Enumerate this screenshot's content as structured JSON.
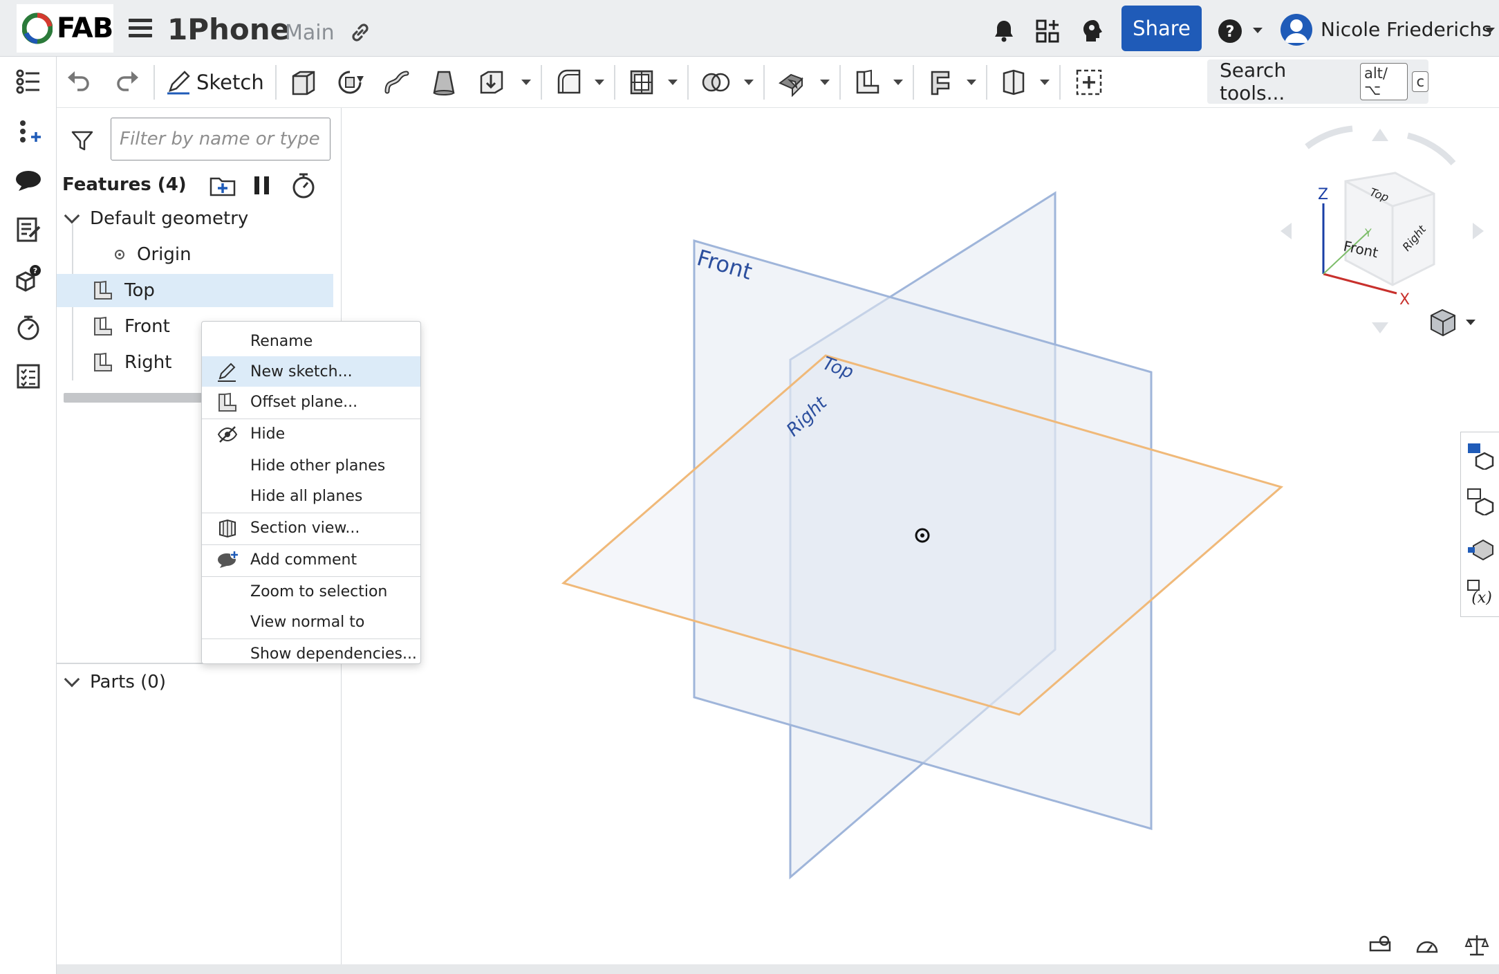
{
  "app": {
    "logo_text": "FAB",
    "document_title": "1Phone",
    "branch": "Main"
  },
  "header": {
    "share_label": "Share",
    "user_name": "Nicole Friederichs"
  },
  "toolbar": {
    "sketch_label": "Sketch",
    "search_label": "Search tools...",
    "search_shortcut_mod": "alt/⌥",
    "search_shortcut_key": "c"
  },
  "feature_panel": {
    "filter_placeholder": "Filter by name or type",
    "features_title": "Features (4)",
    "default_geometry_label": "Default geometry",
    "items": [
      {
        "label": "Origin"
      },
      {
        "label": "Top"
      },
      {
        "label": "Front"
      },
      {
        "label": "Right"
      }
    ],
    "parts_title": "Parts (0)"
  },
  "context_menu": {
    "items": [
      {
        "label": "Rename"
      },
      {
        "label": "New sketch..."
      },
      {
        "label": "Offset plane..."
      },
      {
        "label": "Hide"
      },
      {
        "label": "Hide other planes"
      },
      {
        "label": "Hide all planes"
      },
      {
        "label": "Section view..."
      },
      {
        "label": "Add comment"
      },
      {
        "label": "Zoom to selection"
      },
      {
        "label": "View normal to"
      },
      {
        "label": "Show dependencies..."
      }
    ]
  },
  "viewport": {
    "plane_labels": {
      "front": "Front",
      "top": "Top",
      "right": "Right"
    },
    "view_cube": {
      "top": "Top",
      "front": "Front",
      "right": "Right",
      "axis_x": "X",
      "axis_y": "Y",
      "axis_z": "Z"
    }
  },
  "colors": {
    "share_button": "#1f5bb8",
    "selection_highlight": "#dcebf8",
    "plane_blue": "#8aa6d6",
    "plane_orange": "#f0b979",
    "axis_x": "#c8302c",
    "axis_y": "#7dbd6a",
    "axis_z": "#1a3fa6"
  }
}
